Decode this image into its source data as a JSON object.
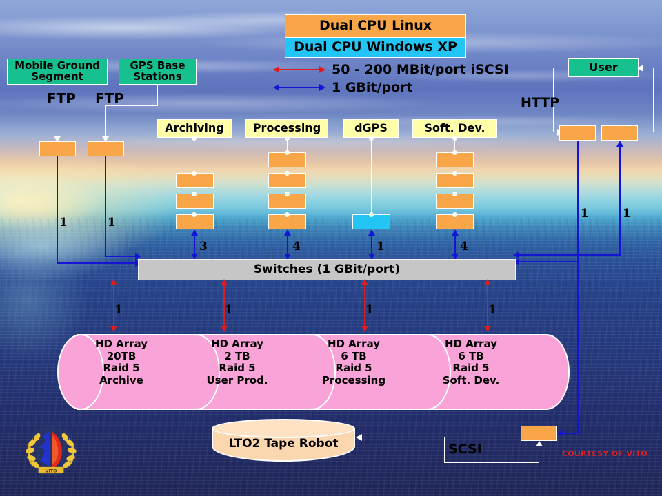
{
  "legend": {
    "linux_box": "Dual CPU Linux",
    "winxp_box": "Dual CPU Windows XP",
    "iscsi_label": "50 - 200 MBit/port iSCSI",
    "gbit_label": "1 GBit/port",
    "colors": {
      "linux": "#f9a649",
      "winxp": "#22c5f4",
      "iscsi_arrow": "#e01b1b",
      "gbit_arrow": "#1414d2"
    }
  },
  "sources": [
    {
      "label": "Mobile Ground\nSegment",
      "color": "#17c08f"
    },
    {
      "label": "GPS Base\nStations",
      "color": "#17c08f"
    }
  ],
  "user": {
    "label": "User",
    "color": "#17c08f"
  },
  "protocols": {
    "ftp_left": "FTP",
    "ftp_right": "FTP",
    "http": "HTTP",
    "scsi": "SCSI"
  },
  "server_groups": [
    {
      "title": "Archiving",
      "server_count": 3,
      "server_color": "#f9a649",
      "port_count": "3"
    },
    {
      "title": "Processing",
      "server_count": 4,
      "server_color": "#f9a649",
      "port_count": "4"
    },
    {
      "title": "dGPS",
      "server_count": 1,
      "server_color": "#22c5f4",
      "port_count": "1"
    },
    {
      "title": "Soft. Dev.",
      "server_count": 4,
      "server_color": "#f9a649",
      "port_count": "4"
    }
  ],
  "ftp_servers": [
    {
      "port_count": "1"
    },
    {
      "port_count": "1"
    }
  ],
  "user_servers": [
    {
      "port_count": "1"
    },
    {
      "port_count": "1"
    }
  ],
  "switches": {
    "label": "Switches (1 GBit/port)",
    "color": "#c6c6c6"
  },
  "hd_arrays": [
    {
      "line1": "HD Array",
      "line2": "20TB",
      "line3": "Raid 5",
      "line4": "Archive",
      "port_count": "1"
    },
    {
      "line1": "HD Array",
      "line2": "2 TB",
      "line3": "Raid 5",
      "line4": "User Prod.",
      "port_count": "1"
    },
    {
      "line1": "HD Array",
      "line2": "6 TB",
      "line3": "Raid 5",
      "line4": "Processing",
      "port_count": "1"
    },
    {
      "line1": "HD Array",
      "line2": "6 TB",
      "line3": "Raid 5",
      "line4": "Soft. Dev.",
      "port_count": "1"
    }
  ],
  "hd_array_color": "#f9a3d8",
  "tape_robot": {
    "label": "LTO2 Tape Robot",
    "color": "#fad7ae"
  },
  "footer": {
    "courtesy": "COURTESY OF VITO",
    "courtesy_color": "#e02020"
  },
  "logo": {
    "name": "vito-crest-emblem"
  }
}
